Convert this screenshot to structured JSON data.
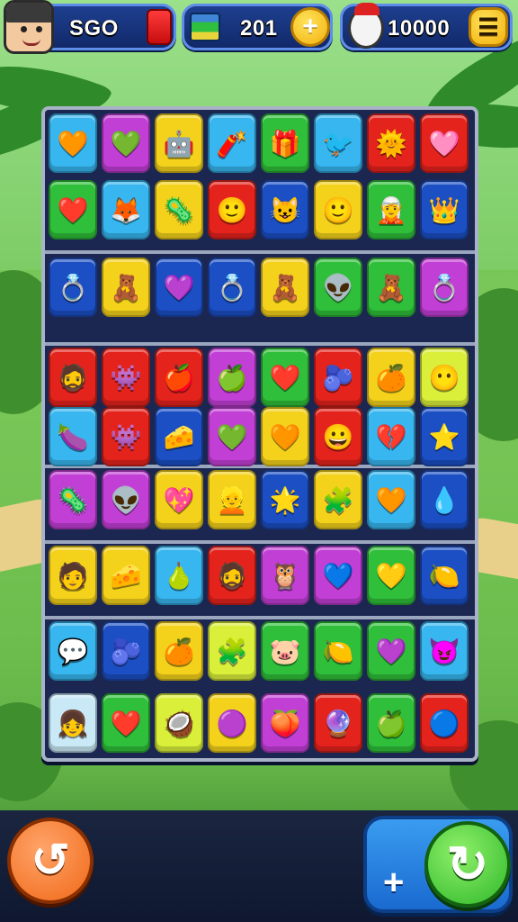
{
  "topbar": {
    "score": "SGO",
    "moves": "201",
    "coins": "10000",
    "add_symbol": "+",
    "menu_symbol": "☰"
  },
  "icons": {
    "player_avatar": "player-avatar",
    "red_card": "red-card-icon",
    "battery": "battery-icon",
    "clown": "clown-icon"
  },
  "board": {
    "rows": [
      [
        {
          "color": "#37b6ef",
          "glyph": "🧡",
          "name": "orange-blob-tile"
        },
        {
          "color": "#c23fd6",
          "glyph": "💚",
          "name": "green-blob-tile"
        },
        {
          "color": "#f4d21c",
          "glyph": "🤖",
          "name": "robot-tile"
        },
        {
          "color": "#37b6ef",
          "glyph": "🧨",
          "name": "firecracker-tile"
        },
        {
          "color": "#2fbf3a",
          "glyph": "🎁",
          "name": "gift-tile"
        },
        {
          "color": "#37b6ef",
          "glyph": "🐦",
          "name": "bird-tile"
        },
        {
          "color": "#e4231d",
          "glyph": "🌞",
          "name": "sun-tile"
        },
        {
          "color": "#e4231d",
          "glyph": "🩷",
          "name": "pink-ring-tile"
        }
      ],
      [
        {
          "color": "#2fbf3a",
          "glyph": "❤️",
          "name": "heart-tile"
        },
        {
          "color": "#37b6ef",
          "glyph": "🦊",
          "name": "fox-tile"
        },
        {
          "color": "#f4d21c",
          "glyph": "🦠",
          "name": "purple-germ-tile"
        },
        {
          "color": "#e4231d",
          "glyph": "🙂",
          "name": "face-tile"
        },
        {
          "color": "#1c4fc4",
          "glyph": "😺",
          "name": "cat-tile"
        },
        {
          "color": "#f4d21c",
          "glyph": "🙂",
          "name": "face-tile"
        },
        {
          "color": "#2fbf3a",
          "glyph": "🧝",
          "name": "elf-tile"
        },
        {
          "color": "#1c4fc4",
          "glyph": "👑",
          "name": "king-tile"
        }
      ],
      [
        {
          "color": "#1c4fc4",
          "glyph": "💍",
          "name": "ring-tile"
        },
        {
          "color": "#f4d21c",
          "glyph": "🧸",
          "name": "bear-tile"
        },
        {
          "color": "#1c4fc4",
          "glyph": "💜",
          "name": "purple-heart-tile"
        },
        {
          "color": "#1c4fc4",
          "glyph": "💍",
          "name": "ring-tile"
        },
        {
          "color": "#f4d21c",
          "glyph": "🧸",
          "name": "bear-tile"
        },
        {
          "color": "#2fbf3a",
          "glyph": "👽",
          "name": "alien-tile"
        },
        {
          "color": "#2fbf3a",
          "glyph": "🧸",
          "name": "bear-tile"
        },
        {
          "color": "#c23fd6",
          "glyph": "💍",
          "name": "ring-tile"
        }
      ],
      [
        {
          "color": "#e4231d",
          "glyph": "🧔",
          "name": "man-tile"
        },
        {
          "color": "#e4231d",
          "glyph": "👾",
          "name": "monster-tile"
        },
        {
          "color": "#e4231d",
          "glyph": "🍎",
          "name": "apple-tile"
        },
        {
          "color": "#c23fd6",
          "glyph": "🍏",
          "name": "green-apple-tile"
        },
        {
          "color": "#2fbf3a",
          "glyph": "❤️",
          "name": "heart-tile"
        },
        {
          "color": "#e4231d",
          "glyph": "🫐",
          "name": "berry-tile"
        },
        {
          "color": "#f4d21c",
          "glyph": "🍊",
          "name": "orange-tile"
        },
        {
          "color": "#d9ef3a",
          "glyph": "😶",
          "name": "blue-face-tile"
        }
      ],
      [
        {
          "color": "#37b6ef",
          "glyph": "🍆",
          "name": "eggplant-tile"
        },
        {
          "color": "#e4231d",
          "glyph": "👾",
          "name": "monster-tile"
        },
        {
          "color": "#1c4fc4",
          "glyph": "🧀",
          "name": "cheese-tile"
        },
        {
          "color": "#c23fd6",
          "glyph": "💚",
          "name": "green-blob-tile"
        },
        {
          "color": "#f4d21c",
          "glyph": "🧡",
          "name": "orange-heart-tile"
        },
        {
          "color": "#e4231d",
          "glyph": "😀",
          "name": "smile-tile"
        },
        {
          "color": "#37b6ef",
          "glyph": "💔",
          "name": "broken-heart-tile"
        },
        {
          "color": "#1c4fc4",
          "glyph": "⭐",
          "name": "star-tile"
        }
      ],
      [
        {
          "color": "#c23fd6",
          "glyph": "🦠",
          "name": "purple-germ-tile"
        },
        {
          "color": "#c23fd6",
          "glyph": "👽",
          "name": "alien-tile"
        },
        {
          "color": "#f4d21c",
          "glyph": "💖",
          "name": "pink-heart-tile"
        },
        {
          "color": "#f4d21c",
          "glyph": "👱",
          "name": "boy-tile"
        },
        {
          "color": "#1c4fc4",
          "glyph": "🌟",
          "name": "burst-tile"
        },
        {
          "color": "#f4d21c",
          "glyph": "🧩",
          "name": "puzzle-tile"
        },
        {
          "color": "#37b6ef",
          "glyph": "🧡",
          "name": "orange-heart-tile"
        },
        {
          "color": "#1c4fc4",
          "glyph": "💧",
          "name": "drop-tile"
        }
      ],
      [
        {
          "color": "#f4d21c",
          "glyph": "🧑",
          "name": "chef-tile"
        },
        {
          "color": "#f4d21c",
          "glyph": "🧀",
          "name": "cheese-tile"
        },
        {
          "color": "#37b6ef",
          "glyph": "🍐",
          "name": "pear-tile"
        },
        {
          "color": "#e4231d",
          "glyph": "🧔",
          "name": "man-tile"
        },
        {
          "color": "#c23fd6",
          "glyph": "🦉",
          "name": "owl-tile"
        },
        {
          "color": "#c23fd6",
          "glyph": "💙",
          "name": "blue-heart-tile"
        },
        {
          "color": "#2fbf3a",
          "glyph": "💛",
          "name": "yellow-leaf-tile"
        },
        {
          "color": "#1c4fc4",
          "glyph": "🍋",
          "name": "lemon-tile"
        }
      ],
      [
        {
          "color": "#37b6ef",
          "glyph": "💬",
          "name": "bubble-tile"
        },
        {
          "color": "#1c4fc4",
          "glyph": "🫐",
          "name": "berry-tile"
        },
        {
          "color": "#f4d21c",
          "glyph": "🍊",
          "name": "orange-tile"
        },
        {
          "color": "#d9ef3a",
          "glyph": "🧩",
          "name": "puzzle-tile"
        },
        {
          "color": "#2fbf3a",
          "glyph": "🐷",
          "name": "pig-tile"
        },
        {
          "color": "#2fbf3a",
          "glyph": "🍋",
          "name": "lemon-tile"
        },
        {
          "color": "#2fbf3a",
          "glyph": "💜",
          "name": "purple-tile"
        },
        {
          "color": "#37b6ef",
          "glyph": "😈",
          "name": "purple-face-tile"
        }
      ],
      [
        {
          "color": "#c8e9f5",
          "glyph": "👧",
          "name": "girl-tile"
        },
        {
          "color": "#2fbf3a",
          "glyph": "❤️",
          "name": "heart-tile"
        },
        {
          "color": "#d9ef3a",
          "glyph": "🥥",
          "name": "nut-tile"
        },
        {
          "color": "#f4d21c",
          "glyph": "🟣",
          "name": "purple-ring-tile"
        },
        {
          "color": "#c23fd6",
          "glyph": "🍑",
          "name": "peach-tile"
        },
        {
          "color": "#e4231d",
          "glyph": "🔮",
          "name": "orb-tile"
        },
        {
          "color": "#2fbf3a",
          "glyph": "🍏",
          "name": "green-apple-tile"
        },
        {
          "color": "#e4231d",
          "glyph": "🔵",
          "name": "blue-ball-tile"
        }
      ]
    ]
  },
  "bottombar": {
    "undo_symbol": "↺",
    "plus_symbol": "+",
    "shuffle_symbol": "↻"
  }
}
